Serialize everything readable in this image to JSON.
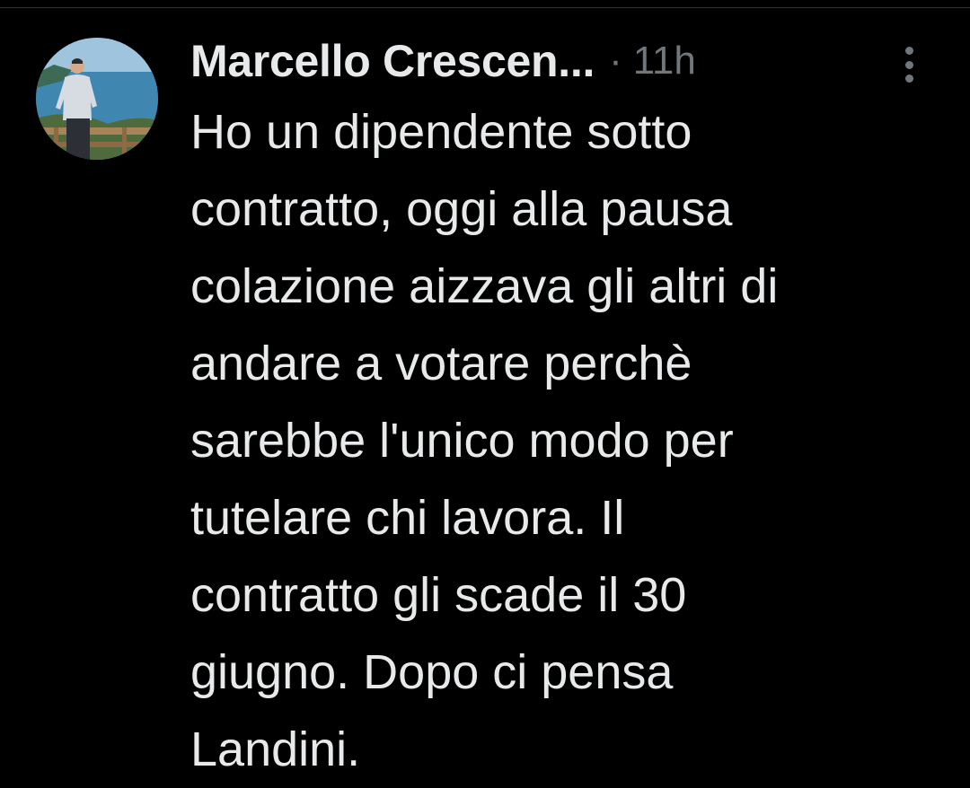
{
  "tweet": {
    "author": {
      "display_name": "Marcello Crescen...",
      "avatar": "profile-photo"
    },
    "separator": "·",
    "timestamp": "11h",
    "more_icon": "more-vertical-icon",
    "text_lines": [
      "Ho un dipendente sotto",
      "contratto, oggi alla pausa",
      "colazione aizzava gli altri di",
      "andare a votare perchè",
      "sarebbe l'unico modo per",
      "tutelare chi lavora. Il",
      "contratto gli scade il 30",
      "giugno. Dopo ci pensa",
      "Landini."
    ]
  },
  "colors": {
    "background": "#000000",
    "text_primary": "#e7e9ea",
    "text_secondary": "#71767b"
  }
}
